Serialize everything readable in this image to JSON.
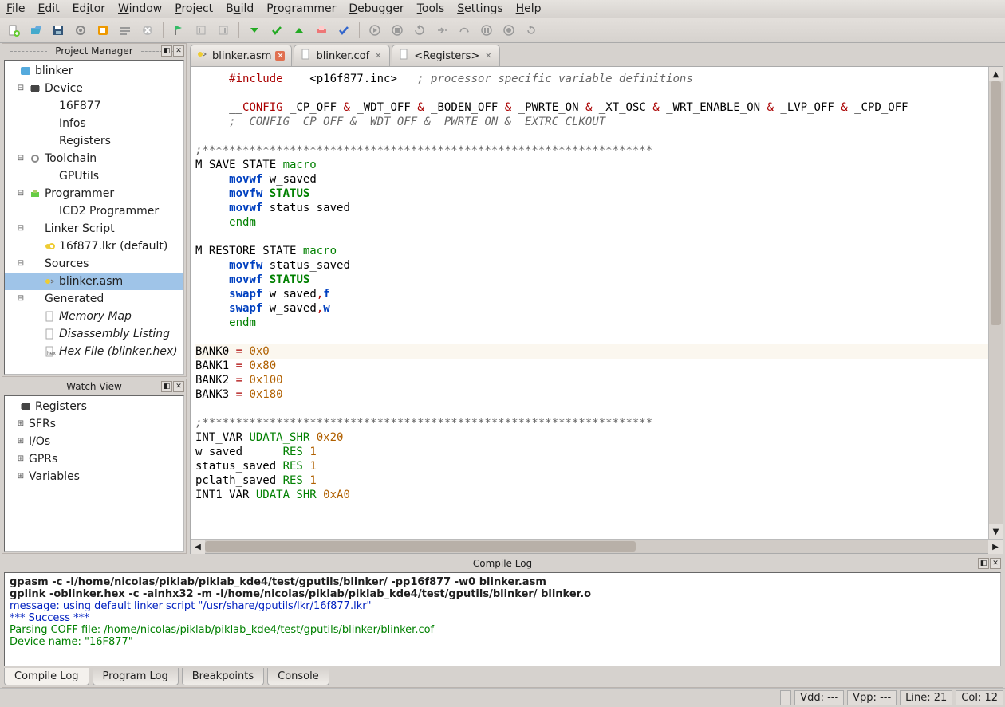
{
  "menu": {
    "file": "File",
    "edit": "Edit",
    "editor": "Editor",
    "window": "Window",
    "project": "Project",
    "build": "Build",
    "programmer": "Programmer",
    "debugger": "Debugger",
    "tools": "Tools",
    "settings": "Settings",
    "help": "Help"
  },
  "toolbar_icons": [
    "new",
    "open",
    "save",
    "settings",
    "pikdev",
    "tool1",
    "cancel",
    "--",
    "flag",
    "col1",
    "col2",
    "--",
    "down",
    "check",
    "up",
    "erase",
    "ok2",
    "--",
    "dbg-run",
    "dbg-stop",
    "dbg-step",
    "dbg-into",
    "dbg-over",
    "dbg-pause",
    "dbg-record",
    "dbg-restart"
  ],
  "panels": {
    "project_manager": "Project Manager",
    "watch_view": "Watch View",
    "compile_log": "Compile Log"
  },
  "project_tree": [
    {
      "depth": 0,
      "label": "blinker",
      "icon": "project"
    },
    {
      "depth": 1,
      "label": "Device",
      "icon": "chip",
      "exp": "-"
    },
    {
      "depth": 2,
      "label": "16F877",
      "icon": "dot",
      "exp": ""
    },
    {
      "depth": 2,
      "label": "Infos",
      "icon": "dot",
      "exp": ""
    },
    {
      "depth": 2,
      "label": "Registers",
      "icon": "dot",
      "exp": ""
    },
    {
      "depth": 1,
      "label": "Toolchain",
      "icon": "gear",
      "exp": "-"
    },
    {
      "depth": 2,
      "label": "GPUtils",
      "icon": "dot",
      "exp": ""
    },
    {
      "depth": 1,
      "label": "Programmer",
      "icon": "prog",
      "exp": "-"
    },
    {
      "depth": 2,
      "label": "ICD2 Programmer",
      "icon": "dot",
      "exp": ""
    },
    {
      "depth": 1,
      "label": "Linker Script",
      "icon": "dot",
      "exp": "-"
    },
    {
      "depth": 2,
      "label": "16f877.lkr (default)",
      "icon": "lkr",
      "exp": ""
    },
    {
      "depth": 1,
      "label": "Sources",
      "icon": "dot",
      "exp": "-"
    },
    {
      "depth": 2,
      "label": "blinker.asm",
      "icon": "asm",
      "exp": "",
      "selected": true
    },
    {
      "depth": 1,
      "label": "Generated",
      "icon": "dot",
      "exp": "-"
    },
    {
      "depth": 2,
      "label": "Memory Map",
      "icon": "file",
      "italic": true
    },
    {
      "depth": 2,
      "label": "Disassembly Listing",
      "icon": "file",
      "italic": true
    },
    {
      "depth": 2,
      "label": "Hex File (blinker.hex)",
      "icon": "hex",
      "italic": true
    }
  ],
  "watch_tree": [
    {
      "depth": 0,
      "label": "Registers",
      "icon": "chip"
    },
    {
      "depth": 1,
      "label": "SFRs",
      "exp": "+"
    },
    {
      "depth": 1,
      "label": "I/Os",
      "exp": "+"
    },
    {
      "depth": 1,
      "label": "GPRs",
      "exp": "+"
    },
    {
      "depth": 1,
      "label": "Variables",
      "exp": "+"
    }
  ],
  "editor_tabs": [
    {
      "label": "blinker.asm",
      "icon": "asm",
      "active": true
    },
    {
      "label": "blinker.cof",
      "icon": "cof"
    },
    {
      "label": "<Registers>",
      "icon": "reg"
    }
  ],
  "editor_lines": [
    {
      "indent": 4,
      "parts": [
        {
          "c": "red",
          "t": "#include"
        },
        {
          "c": "black",
          "t": "    <p16f877.inc>   "
        },
        {
          "c": "gray",
          "t": "; processor specific variable definitions"
        }
      ]
    },
    {
      "blank": true
    },
    {
      "indent": 4,
      "parts": [
        {
          "c": "black",
          "t": "__"
        },
        {
          "c": "red",
          "t": "CONFIG"
        },
        {
          "c": "black",
          "t": " _CP_OFF "
        },
        {
          "c": "red",
          "t": "&"
        },
        {
          "c": "black",
          "t": " _WDT_OFF "
        },
        {
          "c": "red",
          "t": "&"
        },
        {
          "c": "black",
          "t": " _BODEN_OFF "
        },
        {
          "c": "red",
          "t": "&"
        },
        {
          "c": "black",
          "t": " _PWRTE_ON "
        },
        {
          "c": "red",
          "t": "&"
        },
        {
          "c": "black",
          "t": " _XT_OSC "
        },
        {
          "c": "red",
          "t": "&"
        },
        {
          "c": "black",
          "t": " _WRT_ENABLE_ON "
        },
        {
          "c": "red",
          "t": "&"
        },
        {
          "c": "black",
          "t": " _LVP_OFF "
        },
        {
          "c": "red",
          "t": "&"
        },
        {
          "c": "black",
          "t": " _CPD_OFF"
        }
      ]
    },
    {
      "indent": 4,
      "parts": [
        {
          "c": "gray",
          "t": ";__CONFIG _CP_OFF & _WDT_OFF & _PWRTE_ON & _EXTRC_CLKOUT"
        }
      ]
    },
    {
      "blank": true
    },
    {
      "indent": 0,
      "parts": [
        {
          "c": "gray",
          "t": ";*******************************************************************"
        }
      ]
    },
    {
      "indent": 0,
      "parts": [
        {
          "c": "black",
          "t": "M_SAVE_STATE "
        },
        {
          "c": "green",
          "t": "macro"
        }
      ]
    },
    {
      "indent": 4,
      "parts": [
        {
          "c": "blue",
          "t": "movwf"
        },
        {
          "c": "black",
          "t": " w_saved"
        }
      ]
    },
    {
      "indent": 4,
      "parts": [
        {
          "c": "blue",
          "t": "movfw"
        },
        {
          "c": "black",
          "t": " "
        },
        {
          "c": "green",
          "t": "STATUS",
          "bold": true
        }
      ]
    },
    {
      "indent": 4,
      "parts": [
        {
          "c": "blue",
          "t": "movwf"
        },
        {
          "c": "black",
          "t": " status_saved"
        }
      ]
    },
    {
      "indent": 4,
      "parts": [
        {
          "c": "green",
          "t": "endm"
        }
      ]
    },
    {
      "blank": true
    },
    {
      "indent": 0,
      "parts": [
        {
          "c": "black",
          "t": "M_RESTORE_STATE "
        },
        {
          "c": "green",
          "t": "macro"
        }
      ]
    },
    {
      "indent": 4,
      "parts": [
        {
          "c": "blue",
          "t": "movfw"
        },
        {
          "c": "black",
          "t": " status_saved"
        }
      ]
    },
    {
      "indent": 4,
      "parts": [
        {
          "c": "blue",
          "t": "movwf"
        },
        {
          "c": "black",
          "t": " "
        },
        {
          "c": "green",
          "t": "STATUS",
          "bold": true
        }
      ]
    },
    {
      "indent": 4,
      "parts": [
        {
          "c": "blue",
          "t": "swapf"
        },
        {
          "c": "black",
          "t": " w_saved"
        },
        {
          "c": "red",
          "t": ","
        },
        {
          "c": "blue",
          "t": "f"
        }
      ]
    },
    {
      "indent": 4,
      "parts": [
        {
          "c": "blue",
          "t": "swapf"
        },
        {
          "c": "black",
          "t": " w_saved"
        },
        {
          "c": "red",
          "t": ","
        },
        {
          "c": "blue",
          "t": "w"
        }
      ]
    },
    {
      "indent": 4,
      "parts": [
        {
          "c": "green",
          "t": "endm"
        }
      ]
    },
    {
      "blank": true
    },
    {
      "indent": 0,
      "hl": true,
      "parts": [
        {
          "c": "black",
          "t": "BANK0 "
        },
        {
          "c": "red",
          "t": "="
        },
        {
          "c": "black",
          "t": " "
        },
        {
          "c": "orange",
          "t": "0x0"
        }
      ]
    },
    {
      "indent": 0,
      "parts": [
        {
          "c": "black",
          "t": "BANK1 "
        },
        {
          "c": "red",
          "t": "="
        },
        {
          "c": "black",
          "t": " "
        },
        {
          "c": "orange",
          "t": "0x80"
        }
      ]
    },
    {
      "indent": 0,
      "parts": [
        {
          "c": "black",
          "t": "BANK2 "
        },
        {
          "c": "red",
          "t": "="
        },
        {
          "c": "black",
          "t": " "
        },
        {
          "c": "orange",
          "t": "0x100"
        }
      ]
    },
    {
      "indent": 0,
      "parts": [
        {
          "c": "black",
          "t": "BANK3 "
        },
        {
          "c": "red",
          "t": "="
        },
        {
          "c": "black",
          "t": " "
        },
        {
          "c": "orange",
          "t": "0x180"
        }
      ]
    },
    {
      "blank": true
    },
    {
      "indent": 0,
      "parts": [
        {
          "c": "gray",
          "t": ";*******************************************************************"
        }
      ]
    },
    {
      "indent": 0,
      "parts": [
        {
          "c": "black",
          "t": "INT_VAR "
        },
        {
          "c": "green",
          "t": "UDATA_SHR"
        },
        {
          "c": "black",
          "t": " "
        },
        {
          "c": "orange",
          "t": "0x20"
        }
      ]
    },
    {
      "indent": 0,
      "parts": [
        {
          "c": "black",
          "t": "w_saved      "
        },
        {
          "c": "green",
          "t": "RES"
        },
        {
          "c": "black",
          "t": " "
        },
        {
          "c": "orange",
          "t": "1"
        }
      ]
    },
    {
      "indent": 0,
      "parts": [
        {
          "c": "black",
          "t": "status_saved "
        },
        {
          "c": "green",
          "t": "RES"
        },
        {
          "c": "black",
          "t": " "
        },
        {
          "c": "orange",
          "t": "1"
        }
      ]
    },
    {
      "indent": 0,
      "parts": [
        {
          "c": "black",
          "t": "pclath_saved "
        },
        {
          "c": "green",
          "t": "RES"
        },
        {
          "c": "black",
          "t": " "
        },
        {
          "c": "orange",
          "t": "1"
        }
      ]
    },
    {
      "indent": 0,
      "parts": [
        {
          "c": "black",
          "t": "INT1_VAR "
        },
        {
          "c": "green",
          "t": "UDATA_SHR"
        },
        {
          "c": "black",
          "t": " "
        },
        {
          "c": "orange",
          "t": "0xA0"
        }
      ]
    }
  ],
  "compile_log": {
    "lines": [
      {
        "cls": "",
        "text": "gpasm -c -I/home/nicolas/piklab/piklab_kde4/test/gputils/blinker/ -pp16f877 -w0 blinker.asm"
      },
      {
        "cls": "",
        "text": "gplink -oblinker.hex -c -ainhx32 -m -I/home/nicolas/piklab/piklab_kde4/test/gputils/blinker/ blinker.o"
      },
      {
        "cls": "l-blue",
        "text": "message: using default linker script \"/usr/share/gputils/lkr/16f877.lkr\""
      },
      {
        "cls": "l-blue",
        "text": "*** Success ***"
      },
      {
        "cls": "l-green",
        "text": "Parsing COFF file: /home/nicolas/piklab/piklab_kde4/test/gputils/blinker/blinker.cof"
      },
      {
        "cls": "l-green",
        "text": "Device name: \"16F877\""
      }
    ]
  },
  "bottom_tabs": [
    "Compile Log",
    "Program Log",
    "Breakpoints",
    "Console"
  ],
  "status": {
    "vdd": "Vdd: ---",
    "vpp": "Vpp: ---",
    "line": "Line: 21",
    "col": "Col: 12"
  }
}
